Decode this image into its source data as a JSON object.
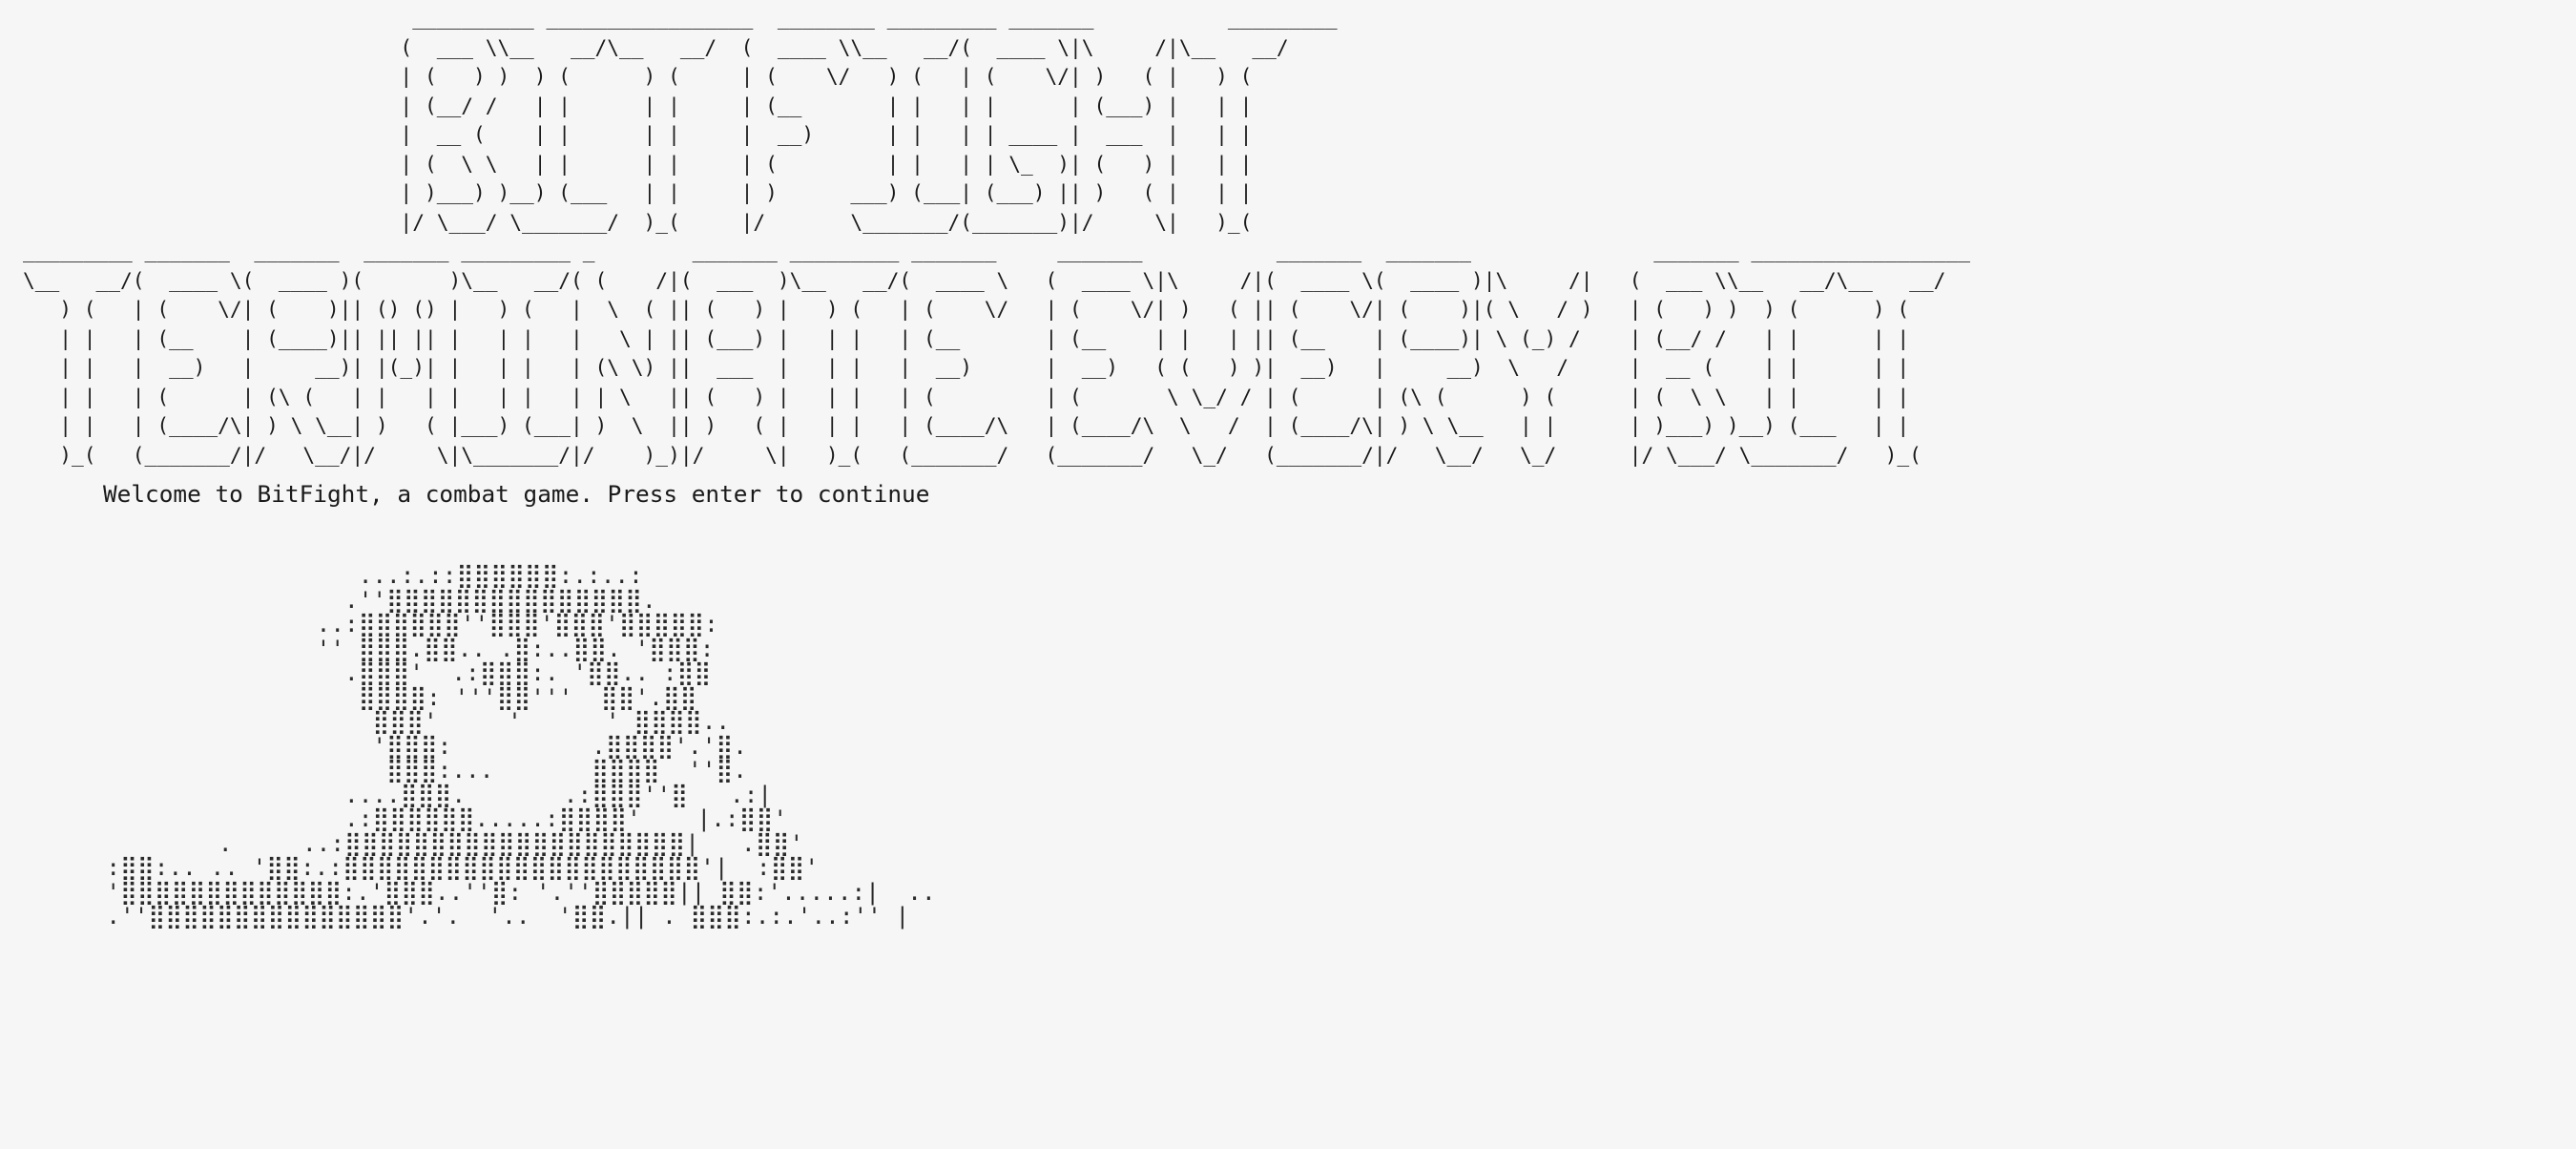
{
  "terminal": {
    "title_art": "                                __________ _________________  ________ _________ _______           _________\n                               (  ___ \\\\__   __/\\__   __/  (  ____ \\\\__   __/(  ____ \\|\\     /|\\__   __/\n                               | (   ) )  ) (      ) (     | (    \\/   ) (   | (    \\/| )   ( |   ) (\n                               | (__/ /   | |      | |     | (__       | |   | |      | (___) |   | |\n                               |  __ (    | |      | |     |  __)      | |   | | ____ |  ___  |   | |\n                               | (  \\ \\   | |      | |     | (         | |   | | \\_  )| (   ) |   | |\n                               | )___) )__) (___   | |     | )      ___) (___| (___) || )   ( |   | |\n                               |/ \\___/ \\_______/  )_(     |/       \\_______/(_______)|/     \\|   )_(\n_________ _______  _______  _______ _________ _        _______ _________ _______     _______           _______  _______               _______ __________________\n\\__   __/(  ____ \\(  ____ )(       )\\__   __/( (    /|(  ___  )\\__   __/(  ____ \\   (  ____ \\|\\     /|(  ____ \\(  ____ )|\\     /|   (  ___ \\\\__   __/\\__   __/\n   ) (   | (    \\/| (    )|| () () |   ) (   |  \\  ( || (   ) |   ) (   | (    \\/   | (    \\/| )   ( || (    \\/| (    )|( \\   / )   | (   ) )  ) (      ) (\n   | |   | (__    | (____)|| || || |   | |   |   \\ | || (___) |   | |   | (__       | (__    | |   | || (__    | (____)| \\ (_) /    | (__/ /   | |      | |\n   | |   |  __)   |     __)| |(_)| |   | |   | (\\ \\) ||  ___  |   | |   |  __)      |  __)   ( (   ) )|  __)   |     __)  \\   /     |  __ (    | |      | |\n   | |   | (      | (\\ (   | |   | |   | |   | | \\   || (   ) |   | |   | (         | (       \\ \\_/ / | (      | (\\ (      ) (      | (  \\ \\   | |      | |\n   | |   | (____/\\| ) \\ \\__| )   ( |___) (___| )  \\  || )   ( |   | |   | (____/\\   | (____/\\  \\   /  | (____/\\| ) \\ \\__   | |      | )___) )__) (___   | |\n   )_(   (_______/|/   \\__/|/     \\|\\_______/|/    )_)|/     \\|   )_(   (_______/   (_______/   \\_/   (_______/|/   \\__/   \\_/      |/ \\___/ \\_______/   )_(",
    "welcome_message": "Welcome to BitFight, a combat game. Press enter to continue",
    "portrait_art": "                    ...:.::⣿⣿⣿⣿⣿⣿:.:..:\n                   .''⣿⣿⣿⣿⣿⣿⣿⣿⣿⣿⣿⣿⣿⣿⣿.\n                 ..:⣿⣿⣿⣿⣿⣿''⣿⣿⣿'⣿⣿⣿'⣿⣿⣿⣿⣿:\n                 '' ⣿⣿⣿.⣿⣿.. .⣿:..⣿⣿. '⣿⣿⣿:\n                   .⣿⣿⣿'  .:⣿⣿⣿:. '⣿⣿.. :⣿⣿\n                    ⣿⣿⣿⣿: '''⣿⣿'''  ⣿⣿'.⣿⣿\n                     ⣿⣿⣿'     '      ' ⣿⣿⣿⣿..\n                     '⣿⣿⣿:          .⣿⣿⣿⣿'.'⣿.\n                      ⣿⣿⣿:...       ⣿⣿⣿⣿  ''⣿.\n                   ....⣿⣿⣿.       .:⣿⣿⣿''⣿   .:|\n                   .:⣿⣿⣿⣿⣿⣿.....:⣿⣿⣿⣿'    |.:⣿⣿'\n          .     ..:⣿⣿⣿⣿⣿⣿⣿⣿⣿⣿⣿⣿⣿⣿⣿⣿⣿⣿⣿⣿|   .⣿⣿'\n  :⣿⣿:.. .. '⣿⣿:.:⣿⣿⣿⣿⣿⣿⣿⣿⣿⣿⣿⣿⣿⣿⣿⣿⣿⣿⣿⣿⣿'|  :⣿⣿'\n  '⣿⣿⣿⣿⣿⣿⣿⣿⣿⣿⣿⣿⣿:.'⣿⣿⣿..''⣿: '.''⣿⣿⣿⣿⣿|| ⣿⣿:'.....:|  ..\n  .''⣿⣿⣿⣿⣿⣿⣿⣿⣿⣿⣿⣿⣿⣿⣿'.'.  '..  '⣿⣿.|| . ⣿⣿⣿:.:.'..:'' |"
  }
}
